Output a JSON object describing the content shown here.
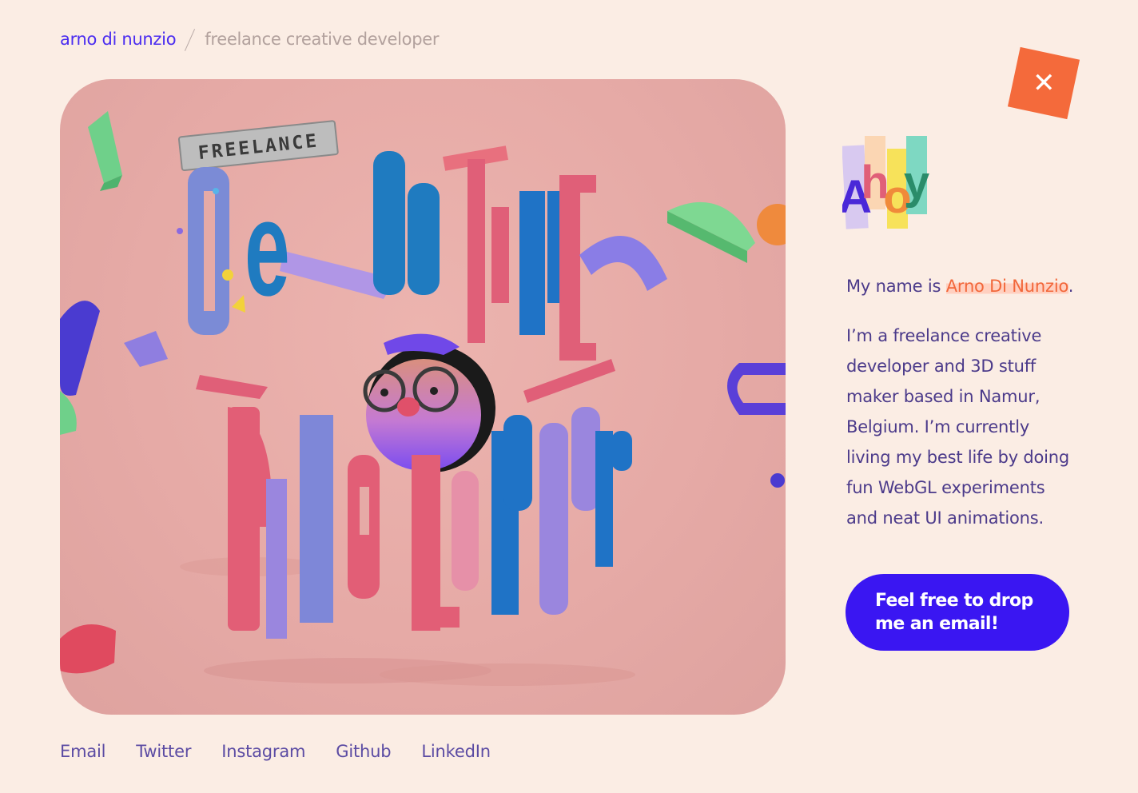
{
  "header": {
    "brand": "arno di nunzio",
    "tagline": "freelance creative developer"
  },
  "close_button": {
    "icon": "close-icon",
    "glyph": "✕",
    "color": "#f46a3b"
  },
  "hero": {
    "sign_text": "FREELANCE",
    "word1": "CReatIVE",
    "word2": "DeVeLoPer",
    "background": "#e6aaa6"
  },
  "ahoy": {
    "letters": [
      "A",
      "h",
      "o",
      "y"
    ]
  },
  "intro": {
    "prefix": "My name is",
    "name": "Arno Di Nunzio",
    "suffix": "."
  },
  "bio": "I’m a freelance creative developer and 3D stuff maker based in Namur, Belgium. I’m currently living my best life by doing fun WebGL experiments and neat UI animations.",
  "cta": {
    "label": "Feel free to drop me an email!",
    "color": "#3a16f2"
  },
  "social_links": [
    {
      "label": "Email"
    },
    {
      "label": "Twitter"
    },
    {
      "label": "Instagram"
    },
    {
      "label": "Github"
    },
    {
      "label": "LinkedIn"
    }
  ]
}
